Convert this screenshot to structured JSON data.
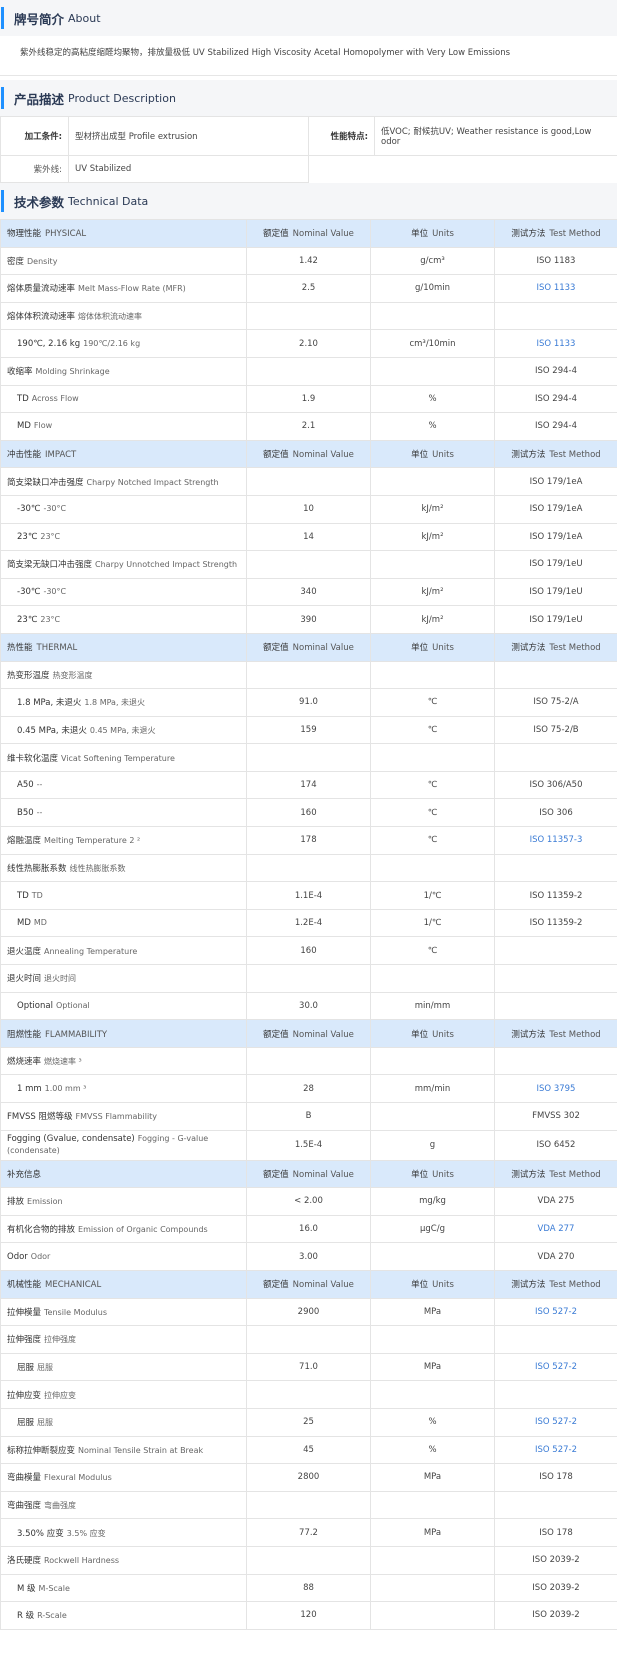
{
  "about": {
    "title_zh": "牌号简介",
    "title_en": "About",
    "body": "紫外线稳定的高粘度缩醛均聚物，排放量极低   UV Stabilized High Viscosity Acetal Homopolymer with Very Low Emissions"
  },
  "product": {
    "title_zh": "产品描述",
    "title_en": "Product Description",
    "process_label": "加工条件:",
    "process_value": "型材挤出成型  Profile extrusion",
    "feature_label": "性能特点:",
    "feature_value": "低VOC; 耐候抗UV;   Weather resistance is good,Low odor",
    "uv_label": "紫外线:",
    "uv_value": "UV Stabilized"
  },
  "tech": {
    "title_zh": "技术参数",
    "title_en": "Technical Data",
    "header": {
      "nominal_zh": "额定值",
      "nominal_en": "Nominal Value",
      "units_zh": "单位",
      "units_en": "Units",
      "method_zh": "测试方法",
      "method_en": "Test Method"
    },
    "rows": [
      {
        "type": "group",
        "zh": "物理性能",
        "en": "PHYSICAL"
      },
      {
        "zh": "密度",
        "en": "Density",
        "value": "1.42",
        "unit": "g/cm³",
        "method": "ISO 1183"
      },
      {
        "zh": "熔体质量流动速率",
        "en": "Melt Mass-Flow Rate (MFR)",
        "value": "2.5",
        "unit": "g/10min",
        "method": "ISO 1133",
        "link": true
      },
      {
        "zh": "熔体体积流动速率",
        "en": "熔体体积流动速率"
      },
      {
        "zh": "190℃, 2.16 kg",
        "en": "190℃/2.16 kg",
        "value": "2.10",
        "unit": "cm³/10min",
        "method": "ISO 1133",
        "link": true,
        "indent": true
      },
      {
        "zh": "收缩率",
        "en": "Molding Shrinkage",
        "method": "ISO 294-4"
      },
      {
        "zh": "TD",
        "en": "Across Flow",
        "value": "1.9",
        "unit": "%",
        "method": "ISO 294-4",
        "indent": true
      },
      {
        "zh": "MD",
        "en": "Flow",
        "value": "2.1",
        "unit": "%",
        "method": "ISO 294-4",
        "indent": true
      },
      {
        "type": "group",
        "zh": "冲击性能",
        "en": "IMPACT"
      },
      {
        "zh": "简支梁缺口冲击强度",
        "en": "Charpy Notched Impact Strength",
        "method": "ISO 179/1eA"
      },
      {
        "zh": "-30℃",
        "en": "-30°C",
        "value": "10",
        "unit": "kJ/m²",
        "method": "ISO 179/1eA",
        "indent": true
      },
      {
        "zh": "23℃",
        "en": "23°C",
        "value": "14",
        "unit": "kJ/m²",
        "method": "ISO 179/1eA",
        "indent": true
      },
      {
        "zh": "简支梁无缺口冲击强度",
        "en": "Charpy Unnotched Impact Strength",
        "method": "ISO 179/1eU"
      },
      {
        "zh": "-30℃",
        "en": "-30°C",
        "value": "340",
        "unit": "kJ/m²",
        "method": "ISO 179/1eU",
        "indent": true
      },
      {
        "zh": "23℃",
        "en": "23°C",
        "value": "390",
        "unit": "kJ/m²",
        "method": "ISO 179/1eU",
        "indent": true
      },
      {
        "type": "group",
        "zh": "热性能",
        "en": "THERMAL"
      },
      {
        "zh": "热变形温度",
        "en": "热变形温度"
      },
      {
        "zh": "1.8 MPa, 未退火",
        "en": "1.8 MPa, 未退火",
        "value": "91.0",
        "unit": "℃",
        "method": "ISO 75-2/A",
        "indent": true
      },
      {
        "zh": "0.45 MPa, 未退火",
        "en": "0.45 MPa, 未退火",
        "value": "159",
        "unit": "℃",
        "method": "ISO 75-2/B",
        "indent": true
      },
      {
        "zh": "维卡软化温度",
        "en": "Vicat Softening Temperature"
      },
      {
        "zh": "A50",
        "en": "--",
        "value": "174",
        "unit": "℃",
        "method": "ISO 306/A50",
        "indent": true
      },
      {
        "zh": "B50",
        "en": "--",
        "value": "160",
        "unit": "℃",
        "method": "ISO 306",
        "indent": true
      },
      {
        "zh": "熔融温度",
        "en": "Melting Temperature  2 ²",
        "value": "178",
        "unit": "℃",
        "method": "ISO 11357-3",
        "link": true
      },
      {
        "zh": "线性热膨胀系数",
        "en": "线性热膨胀系数"
      },
      {
        "zh": "TD",
        "en": "TD",
        "value": "1.1E-4",
        "unit": "1/℃",
        "method": "ISO 11359-2",
        "indent": true
      },
      {
        "zh": "MD",
        "en": "MD",
        "value": "1.2E-4",
        "unit": "1/℃",
        "method": "ISO 11359-2",
        "indent": true
      },
      {
        "zh": "退火温度",
        "en": "Annealing Temperature",
        "value": "160",
        "unit": "℃"
      },
      {
        "zh": "退火时间",
        "en": "退火时间"
      },
      {
        "zh": "Optional",
        "en": "Optional",
        "value": "30.0",
        "unit": "min/mm",
        "indent": true
      },
      {
        "type": "group",
        "zh": "阻燃性能",
        "en": "FLAMMABILITY"
      },
      {
        "zh": "燃烧速率",
        "en": "燃烧速率 ³"
      },
      {
        "zh": "1 mm",
        "en": "1.00 mm ³",
        "value": "28",
        "unit": "mm/min",
        "method": "ISO 3795",
        "link": true,
        "indent": true
      },
      {
        "zh": "FMVSS 阻燃等级",
        "en": "FMVSS Flammability",
        "value": "B",
        "method": "FMVSS 302"
      },
      {
        "zh": "Fogging (Gvalue, condensate)",
        "en": "Fogging - G-value (condensate)",
        "value": "1.5E-4",
        "unit": "g",
        "method": "ISO 6452",
        "tall": true
      },
      {
        "type": "group",
        "zh": "补充信息",
        "en": ""
      },
      {
        "zh": "排放",
        "en": "Emission",
        "value": "< 2.00",
        "unit": "mg/kg",
        "method": "VDA 275"
      },
      {
        "zh": "有机化合物的排放",
        "en": "Emission of Organic Compounds",
        "value": "16.0",
        "unit": "µgC/g",
        "method": "VDA 277",
        "link": true
      },
      {
        "zh": "Odor",
        "en": "Odor",
        "value": "3.00",
        "method": "VDA 270"
      },
      {
        "type": "group",
        "zh": "机械性能",
        "en": "MECHANICAL"
      },
      {
        "zh": "拉伸模量",
        "en": "Tensile Modulus",
        "value": "2900",
        "unit": "MPa",
        "method": "ISO 527-2",
        "link": true
      },
      {
        "zh": "拉伸强度",
        "en": "拉伸强度"
      },
      {
        "zh": "屈服",
        "en": "屈服",
        "value": "71.0",
        "unit": "MPa",
        "method": "ISO 527-2",
        "link": true,
        "indent": true
      },
      {
        "zh": "拉伸应变",
        "en": "拉伸应变"
      },
      {
        "zh": "屈服",
        "en": "屈服",
        "value": "25",
        "unit": "%",
        "method": "ISO 527-2",
        "link": true,
        "indent": true
      },
      {
        "zh": "标称拉伸断裂应变",
        "en": "Nominal Tensile Strain at Break",
        "value": "45",
        "unit": "%",
        "method": "ISO 527-2",
        "link": true
      },
      {
        "zh": "弯曲模量",
        "en": "Flexural Modulus",
        "value": "2800",
        "unit": "MPa",
        "method": "ISO 178"
      },
      {
        "zh": "弯曲强度",
        "en": "弯曲强度"
      },
      {
        "zh": "3.50% 应变",
        "en": "3.5% 应变",
        "value": "77.2",
        "unit": "MPa",
        "method": "ISO 178",
        "indent": true
      },
      {
        "zh": "洛氏硬度",
        "en": "Rockwell Hardness",
        "method": "ISO 2039-2"
      },
      {
        "zh": "M 级",
        "en": "M-Scale",
        "value": "88",
        "method": "ISO 2039-2",
        "indent": true
      },
      {
        "zh": "R 级",
        "en": "R-Scale",
        "value": "120",
        "method": "ISO 2039-2",
        "indent": true
      }
    ]
  }
}
